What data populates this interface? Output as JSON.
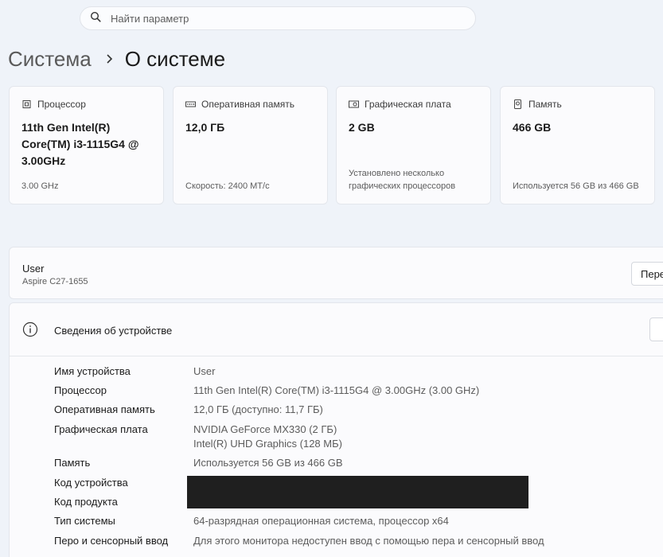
{
  "search": {
    "placeholder": "Найти параметр",
    "icon": "search-icon"
  },
  "breadcrumb": {
    "parent": "Система",
    "current": "О системе"
  },
  "cards": [
    {
      "icon": "processor-icon",
      "title": "Процессор",
      "value": "11th Gen Intel(R) Core(TM) i3-1115G4 @ 3.00GHz",
      "footer": "3.00 GHz"
    },
    {
      "icon": "memory-icon",
      "title": "Оперативная память",
      "value": "12,0 ГБ",
      "footer": "Скорость: 2400 МТ/с"
    },
    {
      "icon": "graphics-card-icon",
      "title": "Графическая плата",
      "value": "2 GB",
      "footer": "Установлено несколько графических процессоров"
    },
    {
      "icon": "storage-icon",
      "title": "Память",
      "value": "466 GB",
      "footer": "Используется 56 GB из 466 GB"
    }
  ],
  "device": {
    "name": "User",
    "model": "Aspire C27-1655",
    "rename_button": "Переименовать"
  },
  "specs": {
    "title": "Сведения об устройстве",
    "rows": [
      {
        "label": "Имя устройства",
        "value": "User"
      },
      {
        "label": "Процессор",
        "value": "11th Gen Intel(R) Core(TM) i3-1115G4 @ 3.00GHz (3.00 GHz)"
      },
      {
        "label": "Оперативная память",
        "value": "12,0 ГБ (доступно: 11,7 ГБ)"
      },
      {
        "label": "Графическая плата",
        "value": "NVIDIA GeForce MX330 (2 ГБ)",
        "value2": "Intel(R) UHD Graphics (128 МБ)"
      },
      {
        "label": "Память",
        "value": "Используется 56 GB из 466 GB"
      },
      {
        "label": "Код устройства",
        "value": ""
      },
      {
        "label": "Код продукта",
        "value": ""
      },
      {
        "label": "Тип системы",
        "value": "64-разрядная операционная система, процессор x64"
      },
      {
        "label": "Перо и сенсорный ввод",
        "value": "Для этого монитора недоступен ввод с помощью пера и сенсорный ввод"
      }
    ]
  },
  "colors": {
    "background": "#eff3f9",
    "card": "#fbfbfd",
    "redaction": "#1f1f1f"
  }
}
